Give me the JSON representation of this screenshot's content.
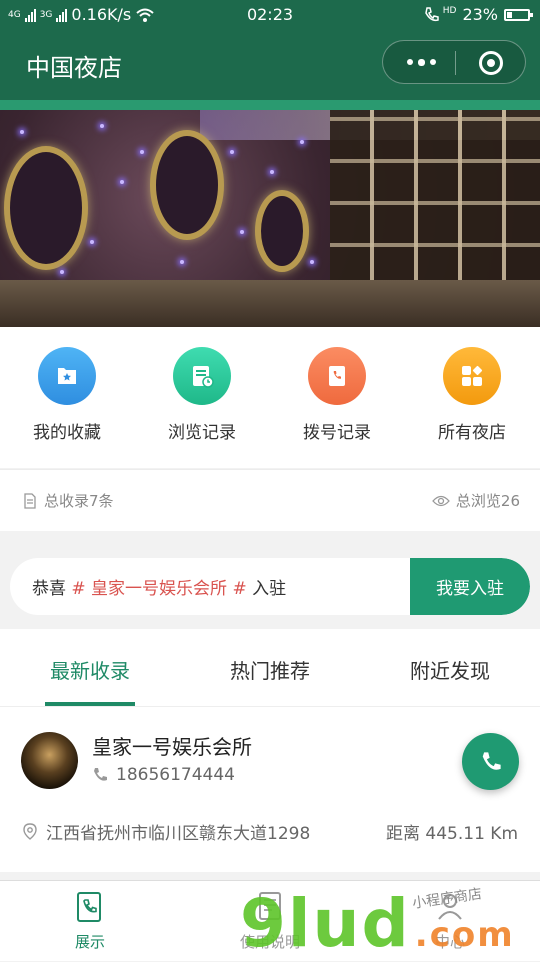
{
  "status_bar": {
    "network_1": "4G",
    "network_2": "3G",
    "speed": "0.16K/s",
    "time": "02:23",
    "call_badge": "HD",
    "battery": "23%",
    "battery_level": 0.23
  },
  "nav": {
    "title": "中国夜店"
  },
  "menu": {
    "items": [
      {
        "label": "我的收藏",
        "icon": "star-folder-icon",
        "color": "#2f9be8"
      },
      {
        "label": "浏览记录",
        "icon": "history-list-icon",
        "color": "#26c59a"
      },
      {
        "label": "拨号记录",
        "icon": "phone-note-icon",
        "color": "#f2744a"
      },
      {
        "label": "所有夜店",
        "icon": "grid-apps-icon",
        "color": "#f5a312"
      }
    ]
  },
  "stats": {
    "total_records": "总收录7条",
    "total_views": "总浏览26"
  },
  "notice": {
    "prefix": "恭喜",
    "highlight": "# 皇家一号娱乐会所 #",
    "suffix": "入驻",
    "button": "我要入驻"
  },
  "tabs": [
    {
      "label": "最新收录",
      "active": true
    },
    {
      "label": "热门推荐",
      "active": false
    },
    {
      "label": "附近发现",
      "active": false
    }
  ],
  "listing": {
    "name": "皇家一号娱乐会所",
    "phone": "18656174444",
    "address": "江西省抚州市临川区赣东大道1298",
    "distance": "距离 445.11 Km"
  },
  "tabbar": [
    {
      "label": "展示",
      "icon": "phone-book-icon",
      "active": true
    },
    {
      "label": "使用说明",
      "icon": "document-icon",
      "active": false
    },
    {
      "label": "中心",
      "icon": "user-icon",
      "active": false
    }
  ],
  "watermark": {
    "main": "9lud",
    "domain": ".com",
    "small": "小程序商店"
  },
  "colors": {
    "primary": "#1d6a4c",
    "accent": "#1f9a72",
    "highlight": "#d9534f"
  }
}
